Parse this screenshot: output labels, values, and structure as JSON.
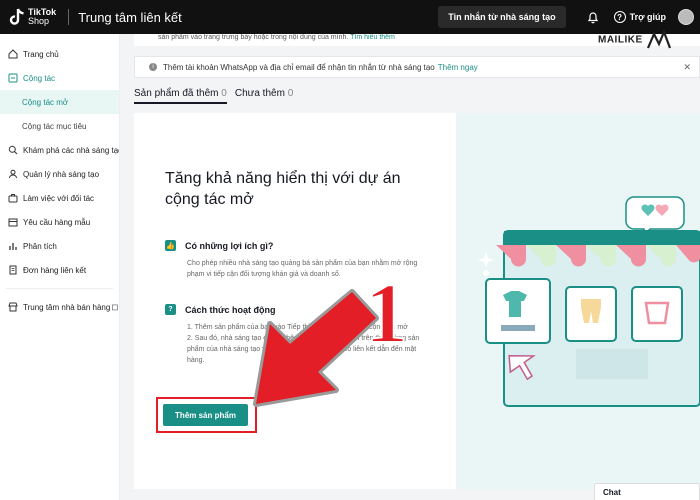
{
  "topbar": {
    "logo_line1": "TikTok",
    "logo_line2": "Shop",
    "title": "Trung tâm liên kết",
    "creator_messages_label": "Tin nhắn từ nhà sáng tạo",
    "help_label": "Trợ giúp"
  },
  "sidebar": {
    "items": [
      {
        "label": "Trang chủ"
      },
      {
        "label": "Cộng tác"
      },
      {
        "label": "Cộng tác mở"
      },
      {
        "label": "Cộng tác mục tiêu"
      },
      {
        "label": "Khám phá các nhà sáng tạo"
      },
      {
        "label": "Quản lý nhà sáng tạo"
      },
      {
        "label": "Làm việc với đối tác"
      },
      {
        "label": "Yêu cầu hàng mẫu"
      },
      {
        "label": "Phân tích"
      },
      {
        "label": "Đơn hàng liên kết"
      },
      {
        "label": "Trung tâm nhà bán hàng"
      }
    ]
  },
  "banner_top": {
    "text": "sản phẩm vào trang trưng bày hoặc trong nội dung của mình.",
    "link": "Tìm hiểu thêm"
  },
  "watermark": "MAILIKE",
  "notice": {
    "text": "Thêm tài khoản WhatsApp và địa chỉ email để nhận tin nhắn từ nhà sáng tạo",
    "link": "Thêm ngay"
  },
  "tabs": [
    {
      "label": "Sản phẩm đã thêm",
      "count": "0"
    },
    {
      "label": "Chưa thêm",
      "count": "0"
    }
  ],
  "card": {
    "headline": "Tăng khả năng hiển thị với dự án cộng tác mở",
    "benefit_title": "Có những lợi ích gì?",
    "benefit_desc": "Cho phép nhiều nhà sáng tạo quảng bá sản phẩm của bạn nhằm mở rộng phạm vi tiếp cận đối tượng khán giả và doanh số.",
    "how_title": "Cách thức hoạt động",
    "step1": "1. Thêm sản phẩm của bạn vào Tiếp thị liên kết thông qua cộng tác mở",
    "step2": "2. Sau đó, nhà sáng tạo có thể thêm sản phẩm của bạn trên thị trường sản phẩm của nhà sáng tạo vào video hoặc phát LIVE có liên kết dẫn đến mặt hàng.",
    "add_button": "Thêm sản phẩm"
  },
  "annotation_number": "1",
  "chat_label": "Chat",
  "colors": {
    "accent": "#1a8f86",
    "highlight": "#e31e26",
    "topbar": "#111111"
  }
}
